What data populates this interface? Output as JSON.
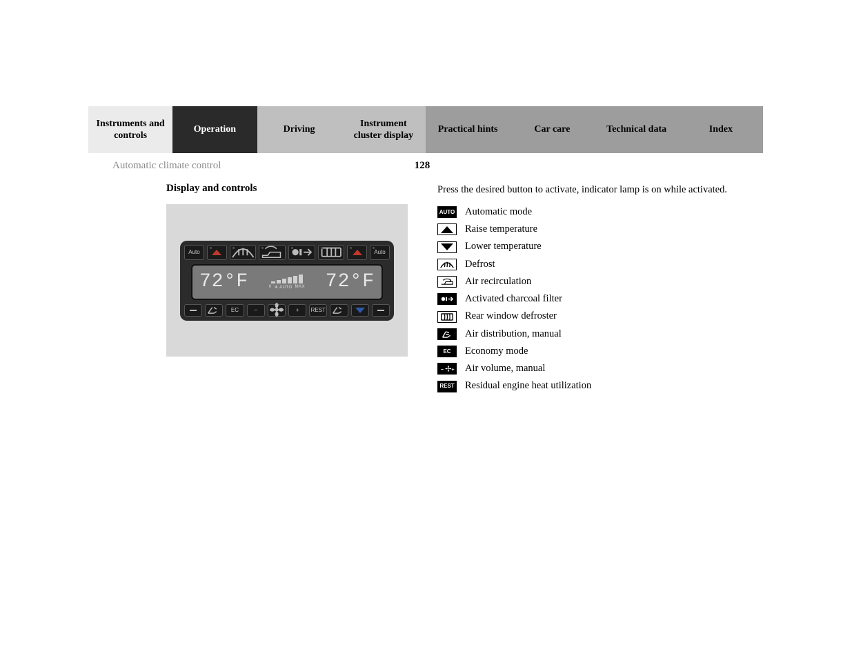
{
  "tabs": [
    {
      "label": "Instruments and controls",
      "style": "light"
    },
    {
      "label": "Operation",
      "style": "active"
    },
    {
      "label": "Driving",
      "style": "mid"
    },
    {
      "label": "Instrument cluster display",
      "style": "mid"
    },
    {
      "label": "Practical hints",
      "style": "dark"
    },
    {
      "label": "Car care",
      "style": "dark"
    },
    {
      "label": "Technical data",
      "style": "dark"
    },
    {
      "label": "Index",
      "style": "dark"
    }
  ],
  "section_title": "Automatic climate control",
  "page_number": "128",
  "left_heading": "Display and controls",
  "panel": {
    "top_row": [
      "Auto",
      "up",
      "defrost",
      "recirc",
      "charcoal",
      "rear",
      "up",
      "Auto"
    ],
    "display": {
      "left_temp": "72°F",
      "right_temp": "72°F",
      "mid_labels": [
        "0",
        "❄ AUTO",
        "MAX"
      ]
    },
    "bottom_row": [
      "minus",
      "airdist",
      "EC",
      "fan_minus",
      "fan",
      "fan_plus",
      "REST",
      "airdist",
      "down",
      "minus"
    ]
  },
  "intro": "Press the desired button to activate, indicator lamp is on while activated.",
  "legend": [
    {
      "icon": "auto",
      "style": "solid",
      "text": "AUTO",
      "label": "Automatic mode"
    },
    {
      "icon": "raise",
      "style": "outline",
      "label": "Raise temperature"
    },
    {
      "icon": "lower",
      "style": "outline",
      "label": "Lower temperature"
    },
    {
      "icon": "defrost",
      "style": "outline",
      "label": "Defrost"
    },
    {
      "icon": "recirc",
      "style": "outline",
      "label": "Air recirculation"
    },
    {
      "icon": "charcoal",
      "style": "solid",
      "label": "Activated charcoal filter"
    },
    {
      "icon": "reardef",
      "style": "outline",
      "label": "Rear window defroster"
    },
    {
      "icon": "airdist",
      "style": "solid",
      "label": "Air distribution, manual"
    },
    {
      "icon": "ec",
      "style": "solid",
      "text": "EC",
      "label": "Economy mode"
    },
    {
      "icon": "airvol",
      "style": "solid",
      "label": "Air volume, manual"
    },
    {
      "icon": "rest",
      "style": "solid",
      "text": "REST",
      "label": "Residual engine heat utilization"
    }
  ]
}
